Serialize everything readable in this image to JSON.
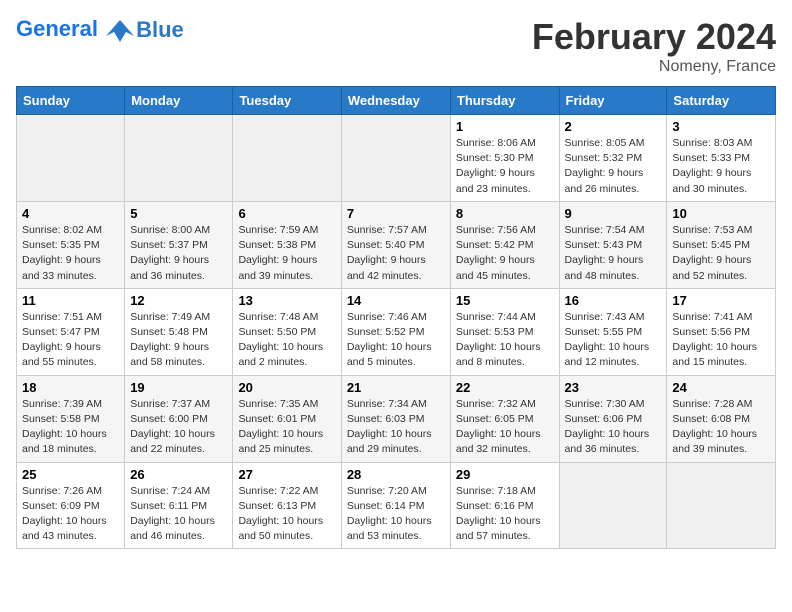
{
  "header": {
    "logo_line1": "General",
    "logo_line2": "Blue",
    "title": "February 2024",
    "subtitle": "Nomeny, France"
  },
  "days_of_week": [
    "Sunday",
    "Monday",
    "Tuesday",
    "Wednesday",
    "Thursday",
    "Friday",
    "Saturday"
  ],
  "weeks": [
    [
      {
        "day": "",
        "empty": true
      },
      {
        "day": "",
        "empty": true
      },
      {
        "day": "",
        "empty": true
      },
      {
        "day": "",
        "empty": true
      },
      {
        "day": "1",
        "sunrise": "8:06 AM",
        "sunset": "5:30 PM",
        "daylight": "9 hours and 23 minutes."
      },
      {
        "day": "2",
        "sunrise": "8:05 AM",
        "sunset": "5:32 PM",
        "daylight": "9 hours and 26 minutes."
      },
      {
        "day": "3",
        "sunrise": "8:03 AM",
        "sunset": "5:33 PM",
        "daylight": "9 hours and 30 minutes."
      }
    ],
    [
      {
        "day": "4",
        "sunrise": "8:02 AM",
        "sunset": "5:35 PM",
        "daylight": "9 hours and 33 minutes."
      },
      {
        "day": "5",
        "sunrise": "8:00 AM",
        "sunset": "5:37 PM",
        "daylight": "9 hours and 36 minutes."
      },
      {
        "day": "6",
        "sunrise": "7:59 AM",
        "sunset": "5:38 PM",
        "daylight": "9 hours and 39 minutes."
      },
      {
        "day": "7",
        "sunrise": "7:57 AM",
        "sunset": "5:40 PM",
        "daylight": "9 hours and 42 minutes."
      },
      {
        "day": "8",
        "sunrise": "7:56 AM",
        "sunset": "5:42 PM",
        "daylight": "9 hours and 45 minutes."
      },
      {
        "day": "9",
        "sunrise": "7:54 AM",
        "sunset": "5:43 PM",
        "daylight": "9 hours and 48 minutes."
      },
      {
        "day": "10",
        "sunrise": "7:53 AM",
        "sunset": "5:45 PM",
        "daylight": "9 hours and 52 minutes."
      }
    ],
    [
      {
        "day": "11",
        "sunrise": "7:51 AM",
        "sunset": "5:47 PM",
        "daylight": "9 hours and 55 minutes."
      },
      {
        "day": "12",
        "sunrise": "7:49 AM",
        "sunset": "5:48 PM",
        "daylight": "9 hours and 58 minutes."
      },
      {
        "day": "13",
        "sunrise": "7:48 AM",
        "sunset": "5:50 PM",
        "daylight": "10 hours and 2 minutes."
      },
      {
        "day": "14",
        "sunrise": "7:46 AM",
        "sunset": "5:52 PM",
        "daylight": "10 hours and 5 minutes."
      },
      {
        "day": "15",
        "sunrise": "7:44 AM",
        "sunset": "5:53 PM",
        "daylight": "10 hours and 8 minutes."
      },
      {
        "day": "16",
        "sunrise": "7:43 AM",
        "sunset": "5:55 PM",
        "daylight": "10 hours and 12 minutes."
      },
      {
        "day": "17",
        "sunrise": "7:41 AM",
        "sunset": "5:56 PM",
        "daylight": "10 hours and 15 minutes."
      }
    ],
    [
      {
        "day": "18",
        "sunrise": "7:39 AM",
        "sunset": "5:58 PM",
        "daylight": "10 hours and 18 minutes."
      },
      {
        "day": "19",
        "sunrise": "7:37 AM",
        "sunset": "6:00 PM",
        "daylight": "10 hours and 22 minutes."
      },
      {
        "day": "20",
        "sunrise": "7:35 AM",
        "sunset": "6:01 PM",
        "daylight": "10 hours and 25 minutes."
      },
      {
        "day": "21",
        "sunrise": "7:34 AM",
        "sunset": "6:03 PM",
        "daylight": "10 hours and 29 minutes."
      },
      {
        "day": "22",
        "sunrise": "7:32 AM",
        "sunset": "6:05 PM",
        "daylight": "10 hours and 32 minutes."
      },
      {
        "day": "23",
        "sunrise": "7:30 AM",
        "sunset": "6:06 PM",
        "daylight": "10 hours and 36 minutes."
      },
      {
        "day": "24",
        "sunrise": "7:28 AM",
        "sunset": "6:08 PM",
        "daylight": "10 hours and 39 minutes."
      }
    ],
    [
      {
        "day": "25",
        "sunrise": "7:26 AM",
        "sunset": "6:09 PM",
        "daylight": "10 hours and 43 minutes."
      },
      {
        "day": "26",
        "sunrise": "7:24 AM",
        "sunset": "6:11 PM",
        "daylight": "10 hours and 46 minutes."
      },
      {
        "day": "27",
        "sunrise": "7:22 AM",
        "sunset": "6:13 PM",
        "daylight": "10 hours and 50 minutes."
      },
      {
        "day": "28",
        "sunrise": "7:20 AM",
        "sunset": "6:14 PM",
        "daylight": "10 hours and 53 minutes."
      },
      {
        "day": "29",
        "sunrise": "7:18 AM",
        "sunset": "6:16 PM",
        "daylight": "10 hours and 57 minutes."
      },
      {
        "day": "",
        "empty": true
      },
      {
        "day": "",
        "empty": true
      }
    ]
  ]
}
